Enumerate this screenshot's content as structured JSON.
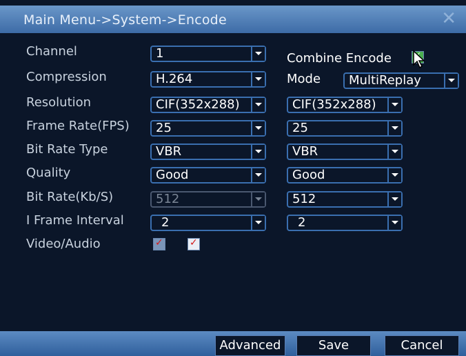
{
  "title": "Main Menu->System->Encode",
  "labels": {
    "channel": "Channel",
    "compression": "Compression",
    "resolution": "Resolution",
    "frame_rate": "Frame Rate(FPS)",
    "bit_rate_type": "Bit Rate Type",
    "quality": "Quality",
    "bit_rate": "Bit Rate(Kb/S)",
    "i_frame": "I Frame Interval",
    "video_audio": "Video/Audio",
    "combine_encode": "Combine Encode",
    "mode": "Mode"
  },
  "main": {
    "channel": "1",
    "compression": "H.264",
    "resolution": "CIF(352x288)",
    "frame_rate": "25",
    "bit_rate_type": "VBR",
    "quality": "Good",
    "bit_rate": "512",
    "i_frame": "2"
  },
  "extra": {
    "mode": "MultiReplay",
    "resolution": "CIF(352x288)",
    "frame_rate": "25",
    "bit_rate_type": "VBR",
    "quality": "Good",
    "bit_rate": "512",
    "i_frame": "2"
  },
  "checkboxes": {
    "combine_encode": true,
    "video": true,
    "audio": true
  },
  "buttons": {
    "advanced": "Advanced",
    "save": "Save",
    "cancel": "Cancel"
  },
  "icons": {
    "close": "close-icon",
    "dropdown": "chevron-down-icon",
    "cursor": "mouse-pointer-icon"
  }
}
